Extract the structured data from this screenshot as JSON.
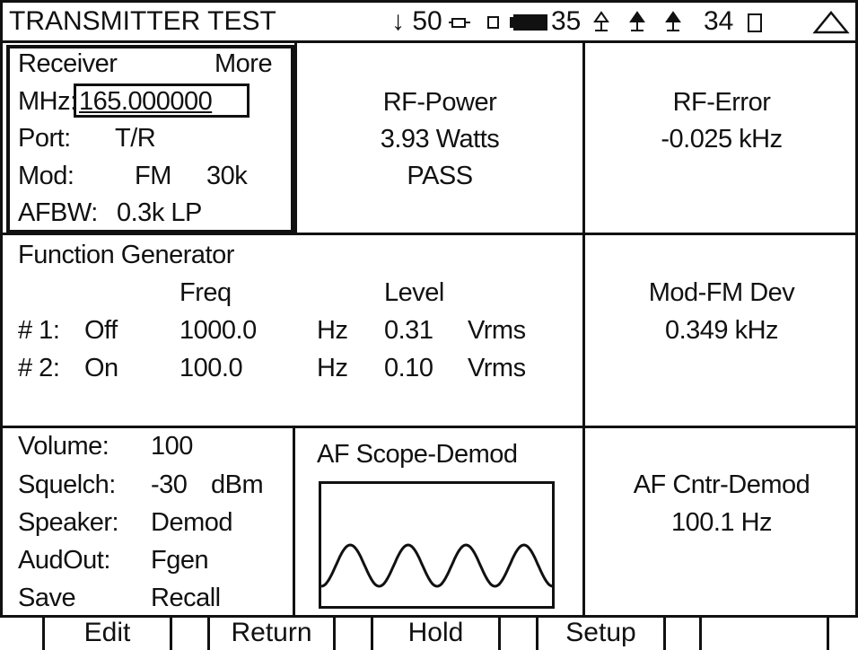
{
  "header": {
    "title": "TRANSMITTER TEST",
    "status_1": "↓ 50",
    "status_icons_1": [
      "plug-icon",
      "square-icon",
      "battery-icon"
    ],
    "status_2": "35",
    "status_icons_2": [
      "antenna-icon",
      "antenna-icon",
      "antenna-icon"
    ],
    "status_3": "34",
    "status_icons_3": [
      "rect-icon",
      "warning-triangle-icon"
    ]
  },
  "receiver": {
    "title": "Receiver",
    "more": "More",
    "mhz_label": "MHz:",
    "mhz_value": "165.000000",
    "port_label": "Port:",
    "port_value": "T/R",
    "mod_label": "Mod:",
    "mod_value": "FM",
    "mod_bw": "30k",
    "afbw_label": "AFBW:",
    "afbw_value": "0.3k LP"
  },
  "rf_power": {
    "label": "RF-Power",
    "value": "3.93 Watts",
    "status": "PASS"
  },
  "rf_error": {
    "label": "RF-Error",
    "value": "-0.025 kHz"
  },
  "function_generator": {
    "title": "Function Generator",
    "freq_header": "Freq",
    "level_header": "Level",
    "rows": [
      {
        "name": "# 1:",
        "state": "Off",
        "freq": "1000.0",
        "freq_unit": "Hz",
        "level": "0.31",
        "level_unit": "Vrms"
      },
      {
        "name": "# 2:",
        "state": "On",
        "freq": "100.0",
        "freq_unit": "Hz",
        "level": "0.10",
        "level_unit": "Vrms"
      }
    ]
  },
  "mod_fm_dev": {
    "label": "Mod-FM Dev",
    "value": "0.349 kHz"
  },
  "audio": {
    "volume_label": "Volume:",
    "volume_value": "100",
    "squelch_label": "Squelch:",
    "squelch_value": "-30",
    "squelch_unit": "dBm",
    "speaker_label": "Speaker:",
    "speaker_value": "Demod",
    "audout_label": "AudOut:",
    "audout_value": "Fgen",
    "save_label": "Save",
    "recall_label": "Recall"
  },
  "scope": {
    "label": "AF Scope-Demod",
    "cycles": 4
  },
  "af_counter": {
    "label": "AF Cntr-Demod",
    "value": "100.1 Hz"
  },
  "softkeys": {
    "edit": "Edit",
    "return": "Return",
    "hold": "Hold",
    "setup": "Setup",
    "blank": ""
  }
}
